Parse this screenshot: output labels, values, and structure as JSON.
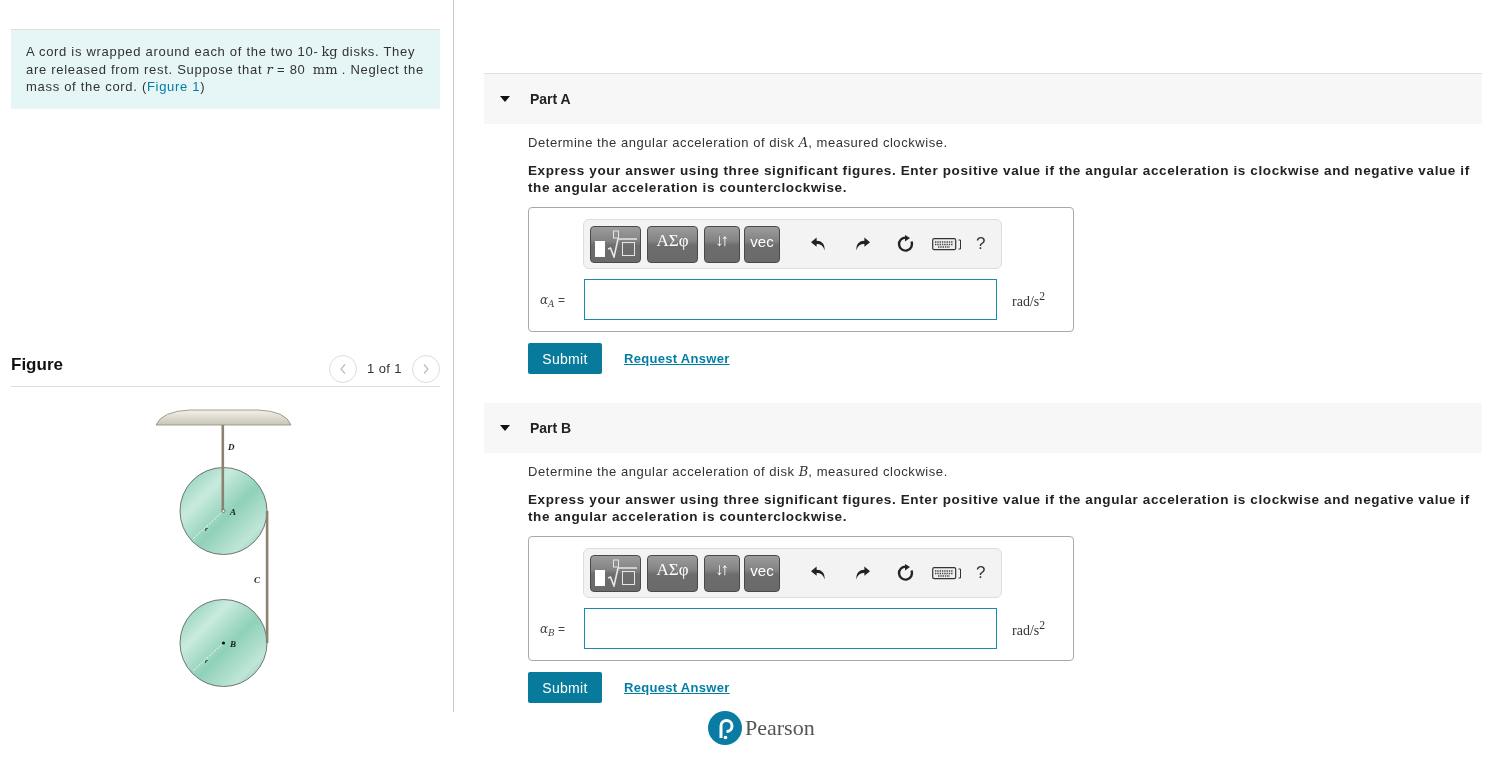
{
  "problem": {
    "segments": [
      {
        "kind": "text",
        "text": "A cord is wrapped around each of the two 10-"
      },
      {
        "kind": "unit",
        "text": "kg"
      },
      {
        "kind": "text",
        "text": " disks. They are released from rest. Suppose that "
      },
      {
        "kind": "var",
        "text": "r"
      },
      {
        "kind": "text",
        "text": " = 80 "
      },
      {
        "kind": "unit",
        "text": "mm"
      },
      {
        "kind": "text",
        "text": " . Neglect the mass of the cord. ("
      },
      {
        "kind": "link",
        "text": "Figure 1"
      },
      {
        "kind": "text",
        "text": ")"
      }
    ]
  },
  "figure": {
    "title": "Figure",
    "pager": "1 of 1",
    "diagram": {
      "cord_labels": [
        "D",
        "C"
      ],
      "disks": [
        {
          "label": "A",
          "radius_label": "r"
        },
        {
          "label": "B",
          "radius_label": "r"
        }
      ]
    }
  },
  "parts": [
    {
      "title": "Part A",
      "expanded": true,
      "prompt": [
        {
          "kind": "text",
          "text": "Determine the angular acceleration of disk "
        },
        {
          "kind": "var",
          "text": "A"
        },
        {
          "kind": "text",
          "text": ", measured clockwise."
        }
      ],
      "instructions": "Express your answer using three significant figures. Enter positive value if the angular acceleration is clockwise and negative value if the angular acceleration is counterclockwise.",
      "toolbar": {
        "symbol_buttons": [
          "ΑΣφ",
          "↓↑",
          "vec"
        ],
        "help": "?"
      },
      "answer_label": {
        "symbol": "α",
        "subscript": "A",
        "relation": "="
      },
      "units": "rad/s$^{2}$",
      "submit": "Submit",
      "request_answer": "Request Answer"
    },
    {
      "title": "Part B",
      "expanded": true,
      "prompt": [
        {
          "kind": "text",
          "text": "Determine the angular acceleration of disk "
        },
        {
          "kind": "var",
          "text": "B"
        },
        {
          "kind": "text",
          "text": ", measured clockwise."
        }
      ],
      "instructions": "Express your answer using three significant figures. Enter positive value if the angular acceleration is clockwise and negative value if the angular acceleration is counterclockwise.",
      "toolbar": {
        "symbol_buttons": [
          "ΑΣφ",
          "↓↑",
          "vec"
        ],
        "help": "?"
      },
      "answer_label": {
        "symbol": "α",
        "subscript": "B",
        "relation": "="
      },
      "units": "rad/s$^{2}$",
      "submit": "Submit",
      "request_answer": "Request Answer"
    }
  ],
  "footer": {
    "logo_text": "Pearson"
  }
}
